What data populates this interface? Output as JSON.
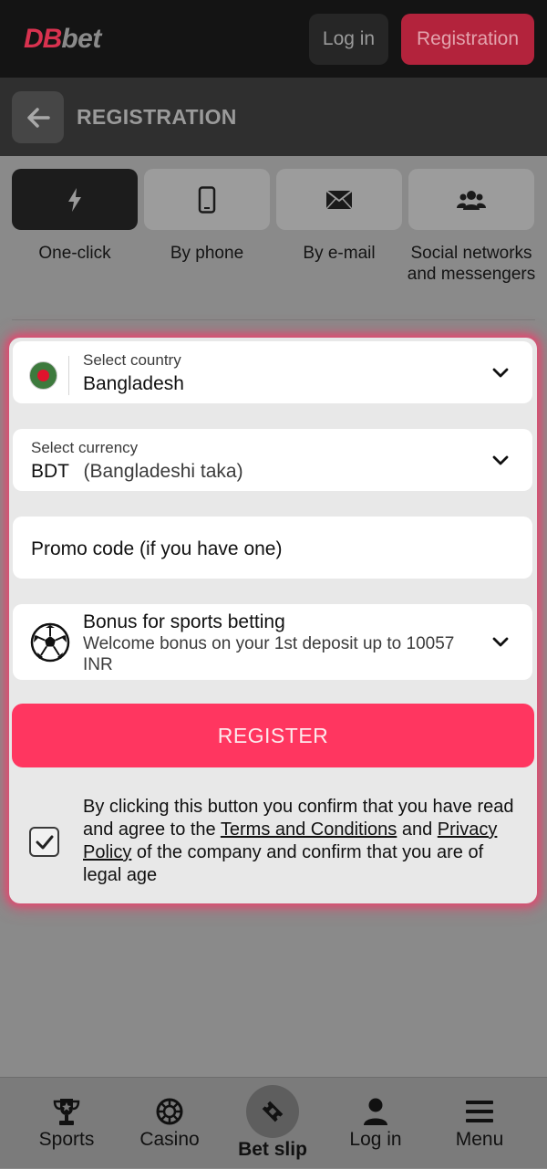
{
  "header": {
    "logo_part1": "DB",
    "logo_part2": "bet",
    "login_label": "Log in",
    "registration_label": "Registration"
  },
  "subheader": {
    "title": "REGISTRATION"
  },
  "methods": [
    {
      "label": "One-click",
      "icon": "lightning-icon",
      "active": true
    },
    {
      "label": "By phone",
      "icon": "phone-icon",
      "active": false
    },
    {
      "label": "By e-mail",
      "icon": "envelope-icon",
      "active": false
    },
    {
      "label": "Social networks and messengers",
      "icon": "users-icon",
      "active": false
    }
  ],
  "form": {
    "country": {
      "label": "Select country",
      "value": "Bangladesh",
      "flag": "bangladesh-flag"
    },
    "currency": {
      "label": "Select currency",
      "code": "BDT",
      "name": "(Bangladeshi taka)"
    },
    "promo": {
      "placeholder": "Promo code (if you have one)"
    },
    "bonus": {
      "title": "Bonus for sports betting",
      "description": "Welcome bonus on your 1st deposit up to 10057 INR",
      "icon": "soccer-ball-icon"
    },
    "register_label": "REGISTER",
    "consent": {
      "checked": true,
      "text_before": "By clicking this button you confirm that you have read and agree to the ",
      "terms_link": "Terms and Conditions",
      "text_middle": " and ",
      "privacy_link": "Privacy Policy",
      "text_after": " of the company and confirm that you are of legal age"
    }
  },
  "bottom_nav": [
    {
      "label": "Sports",
      "icon": "trophy-icon"
    },
    {
      "label": "Casino",
      "icon": "casino-chip-icon"
    },
    {
      "label": "Bet slip",
      "icon": "ticket-icon"
    },
    {
      "label": "Log in",
      "icon": "user-icon"
    },
    {
      "label": "Menu",
      "icon": "hamburger-icon"
    }
  ],
  "colors": {
    "accent": "#ff3660",
    "header_bg": "#141414",
    "overlay_bg": "#8a8a8a"
  }
}
